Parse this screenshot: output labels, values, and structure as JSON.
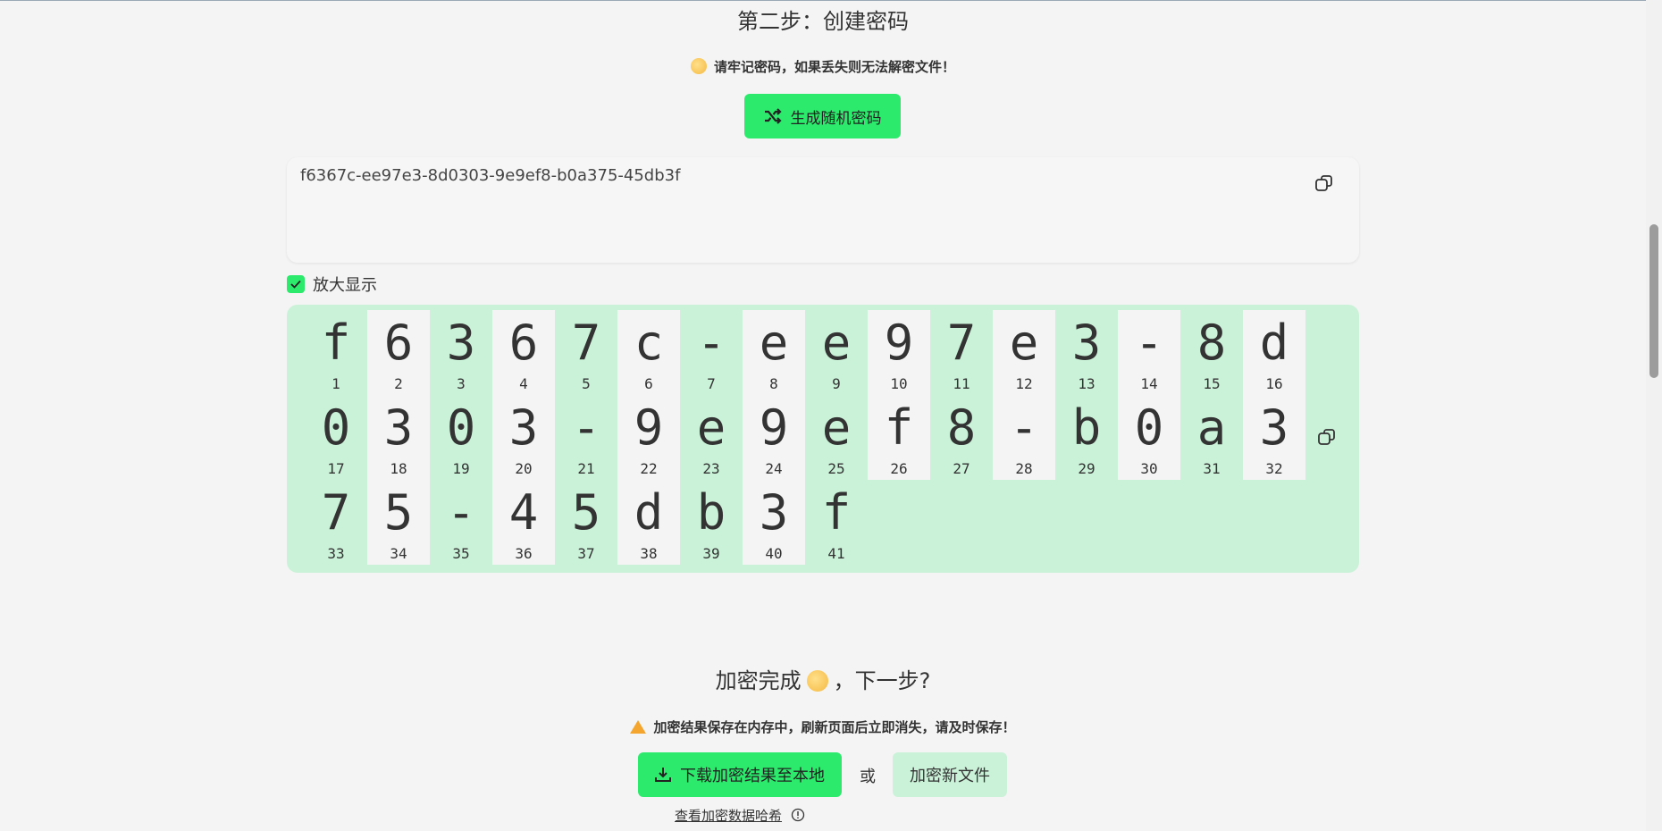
{
  "step2": {
    "title": "第二步：创建密码",
    "warning": "请牢记密码，如果丢失则无法解密文件！",
    "generate_label": "生成随机密码",
    "password": "f6367c-ee97e3-8d0303-9e9ef8-b0a375-45db3f",
    "zoom_label": "放大显示",
    "chars": [
      "f",
      "6",
      "3",
      "6",
      "7",
      "c",
      "-",
      "e",
      "e",
      "9",
      "7",
      "e",
      "3",
      "-",
      "8",
      "d",
      "0",
      "3",
      "0",
      "3",
      "-",
      "9",
      "e",
      "9",
      "e",
      "f",
      "8",
      "-",
      "b",
      "0",
      "a",
      "3",
      "7",
      "5",
      "-",
      "4",
      "5",
      "d",
      "b",
      "3",
      "f"
    ]
  },
  "done": {
    "title_part1": "加密完成",
    "title_part2": "，下一步?",
    "warning": "加密结果保存在内存中，刷新页面后立即消失，请及时保存！",
    "download_label": "下载加密结果至本地",
    "or_label": "或",
    "new_file_label": "加密新文件",
    "hash_link": "查看加密数据哈希"
  },
  "colors": {
    "accent": "#2bea6c",
    "accent_light": "#caf2d8",
    "background": "#f4f4f4"
  },
  "icons": {
    "generate": "shuffle-icon",
    "copy": "copy-icon",
    "download": "download-icon",
    "info": "info-icon"
  }
}
